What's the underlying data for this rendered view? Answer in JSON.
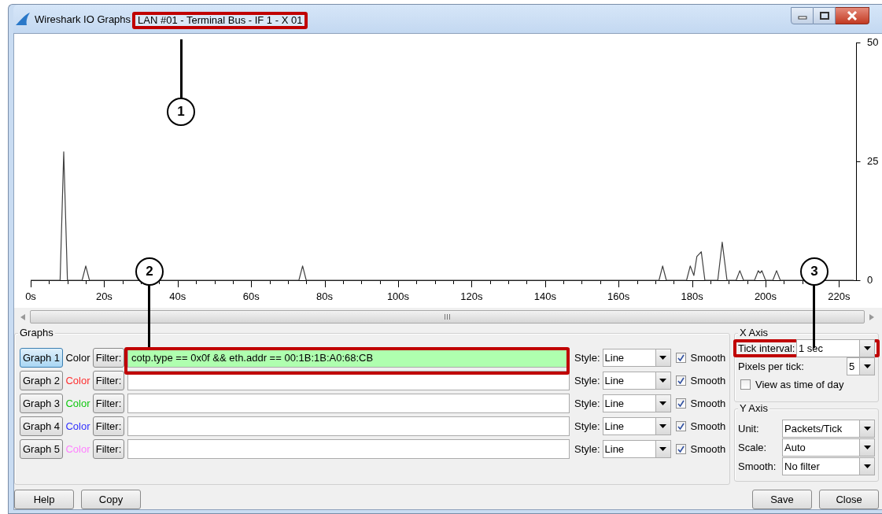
{
  "window": {
    "app_title": "Wireshark IO Graphs",
    "capture_title": "LAN #01 - Terminal Bus - IF 1 - X 01"
  },
  "chart": {
    "chart_data": {
      "type": "line",
      "x": [
        0,
        8,
        9,
        10,
        14,
        15,
        16,
        73,
        74,
        75,
        171,
        172,
        173,
        178.5,
        179.5,
        180.5,
        181.3,
        182.5,
        183.5,
        187,
        188.2,
        189.5,
        192,
        193,
        194,
        197,
        198,
        198.5,
        199,
        200,
        202,
        203,
        204,
        224
      ],
      "series": [
        {
          "color": "#404040",
          "values": [
            0,
            0,
            27,
            0,
            0,
            3,
            0,
            0,
            3,
            0,
            0,
            3,
            0,
            0,
            3,
            1,
            5,
            6,
            0,
            0,
            8,
            0,
            0,
            2,
            0,
            0,
            2,
            1.5,
            2,
            0,
            0,
            2,
            0,
            0
          ]
        }
      ],
      "xlim": [
        0,
        224
      ],
      "ylim": [
        0,
        50
      ],
      "xticks": [
        {
          "value": 0,
          "label": "0s"
        },
        {
          "value": 20,
          "label": "20s"
        },
        {
          "value": 40,
          "label": "40s"
        },
        {
          "value": 60,
          "label": "60s"
        },
        {
          "value": 80,
          "label": "80s"
        },
        {
          "value": 100,
          "label": "100s"
        },
        {
          "value": 120,
          "label": "120s"
        },
        {
          "value": 140,
          "label": "140s"
        },
        {
          "value": 160,
          "label": "160s"
        },
        {
          "value": 180,
          "label": "180s"
        },
        {
          "value": 200,
          "label": "200s"
        },
        {
          "value": 220,
          "label": "220s"
        }
      ],
      "yticks": [
        0,
        25,
        50
      ]
    }
  },
  "graphs_group": {
    "title": "Graphs",
    "rows": [
      {
        "button": "Graph 1",
        "selected": true,
        "color_label": "Color",
        "color": "#000000",
        "filter_button": "Filter:",
        "filter": "cotp.type == 0x0f && eth.addr == 00:1B:1B:A0:68:CB",
        "valid": true,
        "style_label": "Style:",
        "style": "Line",
        "smooth_label": "Smooth",
        "smooth": true
      },
      {
        "button": "Graph 2",
        "selected": false,
        "color_label": "Color",
        "color": "#ff3030",
        "filter_button": "Filter:",
        "valid": false,
        "style_label": "Style:",
        "style": "Line",
        "smooth_label": "Smooth",
        "smooth": true
      },
      {
        "button": "Graph 3",
        "selected": false,
        "color_label": "Color",
        "color": "#10c810",
        "filter_button": "Filter:",
        "valid": false,
        "style_label": "Style:",
        "style": "Line",
        "smooth_label": "Smooth",
        "smooth": true
      },
      {
        "button": "Graph 4",
        "selected": false,
        "color_label": "Color",
        "color": "#3030ff",
        "filter_button": "Filter:",
        "valid": false,
        "style_label": "Style:",
        "style": "Line",
        "smooth_label": "Smooth",
        "smooth": true
      },
      {
        "button": "Graph 5",
        "selected": false,
        "color_label": "Color",
        "color": "#ff80ff",
        "filter_button": "Filter:",
        "valid": false,
        "style_label": "Style:",
        "style": "Line",
        "smooth_label": "Smooth",
        "smooth": true
      }
    ]
  },
  "x_axis": {
    "title": "X Axis",
    "tick_interval_label": "Tick interval:",
    "tick_interval": "1 sec",
    "pixels_per_tick_label": "Pixels per tick:",
    "pixels_per_tick": "5",
    "time_of_day_label": "View as time of day",
    "time_of_day": false
  },
  "y_axis": {
    "title": "Y Axis",
    "fields": [
      {
        "label": "Unit:",
        "value": "Packets/Tick"
      },
      {
        "label": "Scale:",
        "value": "Auto"
      },
      {
        "label": "Smooth:",
        "value": "No filter"
      }
    ]
  },
  "buttons_left": [
    "Help",
    "Copy"
  ],
  "buttons_right": [
    "Save",
    "Close"
  ],
  "callouts": [
    {
      "number": "1"
    },
    {
      "number": "2"
    },
    {
      "number": "3"
    }
  ]
}
